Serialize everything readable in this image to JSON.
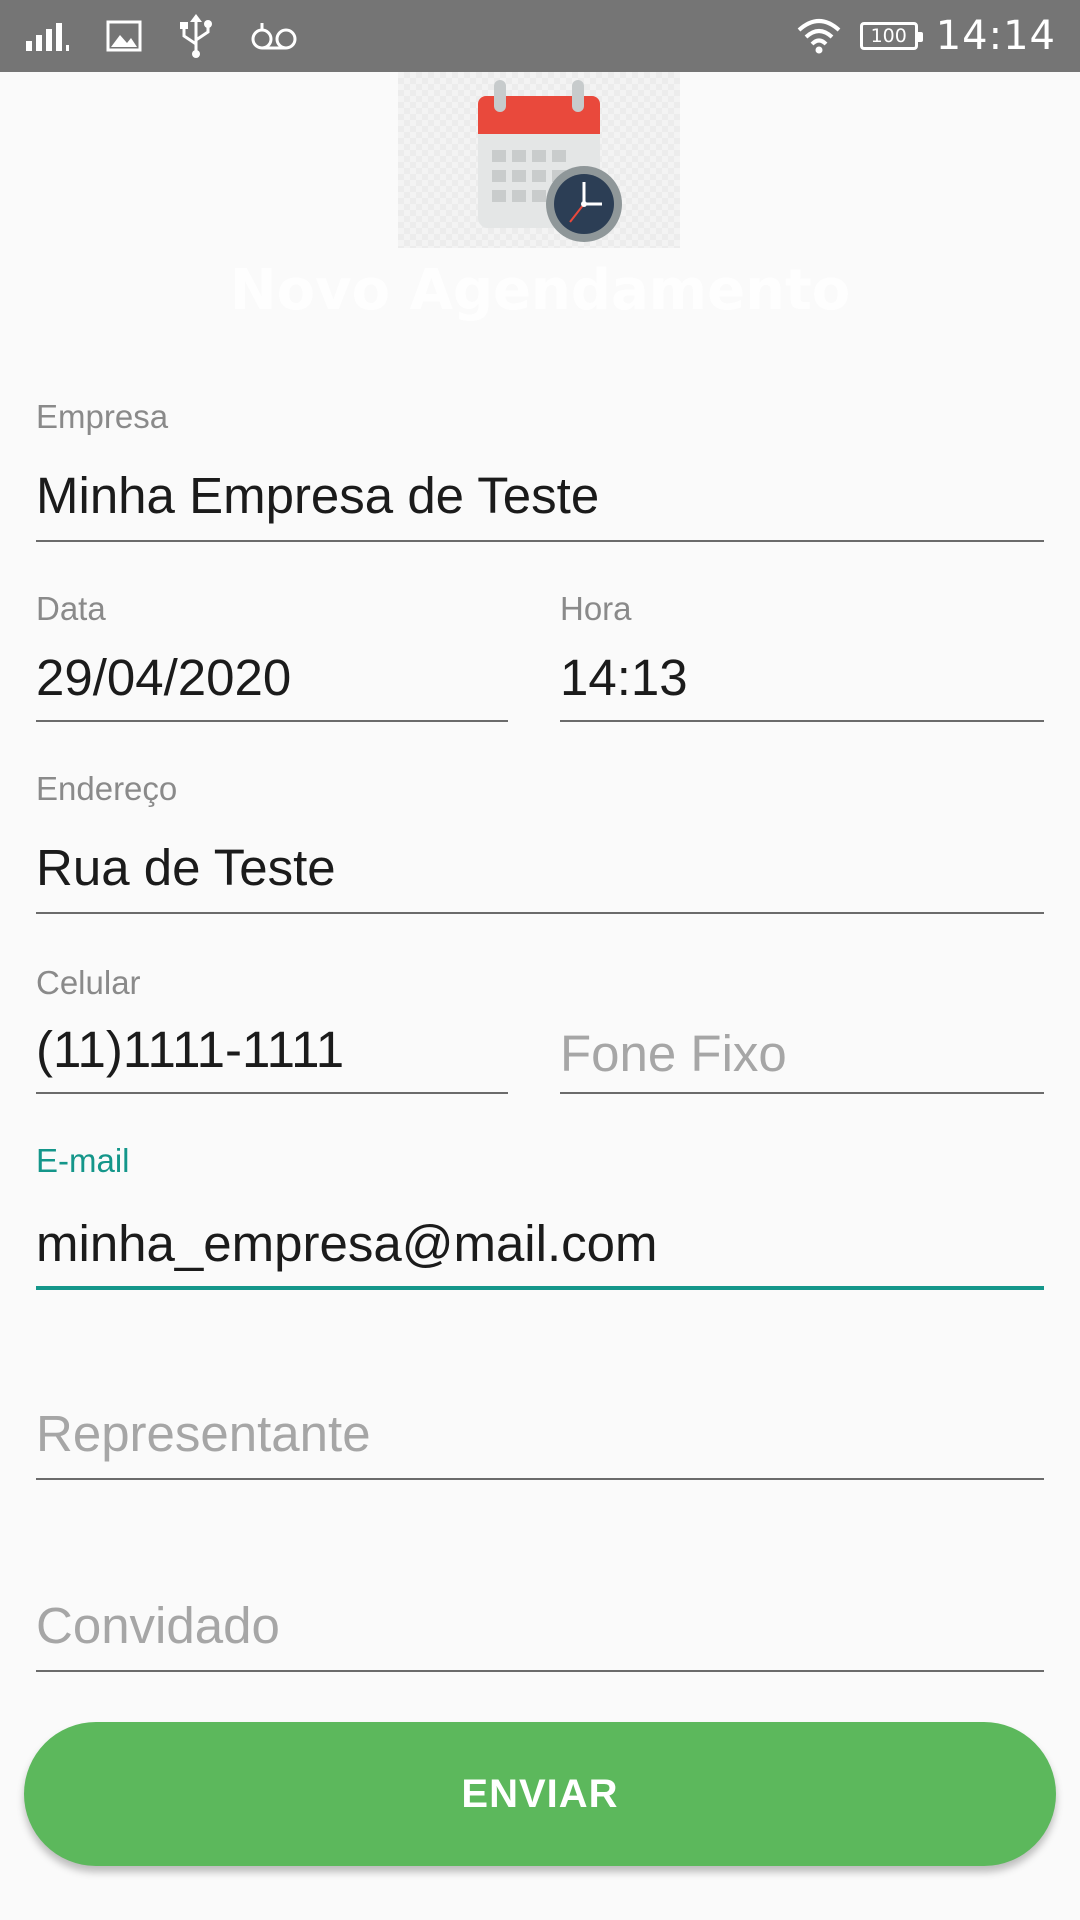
{
  "status_bar": {
    "time": "14:14",
    "battery_level": "100",
    "icons": [
      "signal-icon",
      "image-icon",
      "usb-icon",
      "voicemail-icon",
      "wifi-icon",
      "battery-icon"
    ]
  },
  "header": {
    "icon": "calendar-clock-icon",
    "title": "Novo Agendamento"
  },
  "form": {
    "empresa": {
      "label": "Empresa",
      "value": "Minha Empresa de Teste"
    },
    "data": {
      "label": "Data",
      "value": "29/04/2020"
    },
    "hora": {
      "label": "Hora",
      "value": "14:13"
    },
    "endereco": {
      "label": "Endereço",
      "value": "Rua de Teste"
    },
    "celular": {
      "label": "Celular",
      "value": "(11)1111-1111"
    },
    "fone_fixo": {
      "placeholder": "Fone Fixo",
      "value": ""
    },
    "email": {
      "label": "E-mail",
      "value": "minha_empresa@mail.com"
    },
    "representante": {
      "placeholder": "Representante",
      "value": ""
    },
    "convidado": {
      "placeholder": "Convidado",
      "value": ""
    }
  },
  "actions": {
    "send_label": "ENVIAR"
  },
  "colors": {
    "status_bar": "#757575",
    "accent": "#14968a",
    "button": "#5cb85c",
    "background": "#fafafa"
  }
}
